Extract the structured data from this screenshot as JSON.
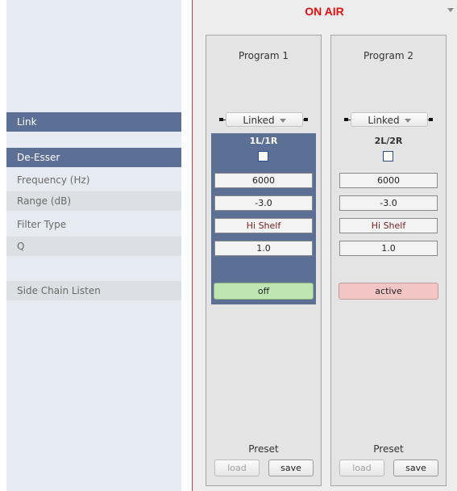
{
  "header": {
    "on_air": "ON AIR"
  },
  "sidebar": {
    "link": "Link",
    "de_esser": "De-Esser",
    "frequency": "Frequency (Hz)",
    "range": "Range (dB)",
    "filter_type": "Filter Type",
    "q": "Q",
    "side_chain_listen": "Side Chain Listen"
  },
  "columns": [
    {
      "title": "Program 1",
      "link": "Linked",
      "channel": "1L/1R",
      "enabled": false,
      "frequency": "6000",
      "range": "-3.0",
      "filter_type": "Hi Shelf",
      "q": "1.0",
      "side_chain": "off",
      "preset_label": "Preset",
      "load": "load",
      "save": "save"
    },
    {
      "title": "Program 2",
      "link": "Linked",
      "channel": "2L/2R",
      "enabled": false,
      "frequency": "6000",
      "range": "-3.0",
      "filter_type": "Hi Shelf",
      "q": "1.0",
      "side_chain": "active",
      "preset_label": "Preset",
      "load": "load",
      "save": "save"
    }
  ],
  "colors": {
    "on_air": "#e01010",
    "header_row": "#5b7094",
    "side_chain_off": "#bfe6b1",
    "side_chain_active": "#f3c6c6"
  }
}
